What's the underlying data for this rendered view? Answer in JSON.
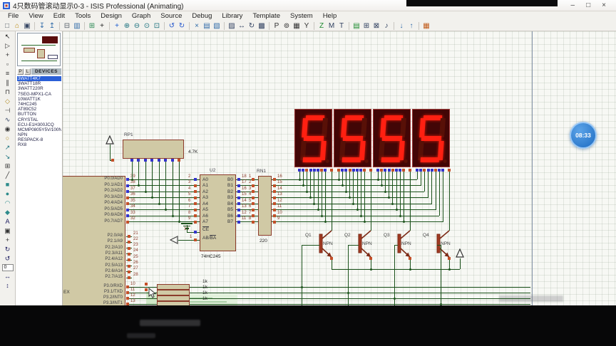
{
  "window": {
    "title": "4只数码管滚动显示0-3 - ISIS Professional (Animating)",
    "controls": {
      "minimize": "–",
      "maximize": "□",
      "close": "×"
    }
  },
  "menu": {
    "items": [
      "File",
      "View",
      "Edit",
      "Tools",
      "Design",
      "Graph",
      "Source",
      "Debug",
      "Library",
      "Template",
      "System",
      "Help"
    ]
  },
  "toolbar": {
    "icons": [
      {
        "name": "new-file-icon",
        "glyph": "□",
        "color": "#55606a"
      },
      {
        "name": "open-design-icon",
        "glyph": "⌂",
        "color": "#b8860b"
      },
      {
        "name": "save-design-icon",
        "glyph": "▣",
        "color": "#3a4a66"
      },
      {
        "name": "separator"
      },
      {
        "name": "import-section-icon",
        "glyph": "↧",
        "color": "#2e6aa8"
      },
      {
        "name": "export-section-icon",
        "glyph": "↥",
        "color": "#2e6aa8"
      },
      {
        "name": "separator"
      },
      {
        "name": "print-icon",
        "glyph": "⊟",
        "color": "#55606a"
      },
      {
        "name": "mark-output-area-icon",
        "glyph": "▥",
        "color": "#2e6aa8"
      },
      {
        "name": "separator"
      },
      {
        "name": "toggle-grid-icon",
        "glyph": "⊞",
        "color": "#2e8b57"
      },
      {
        "name": "false-origin-icon",
        "glyph": "+",
        "color": "#222222"
      },
      {
        "name": "separator"
      },
      {
        "name": "pan-icon",
        "glyph": "+",
        "color": "#1a5ad0"
      },
      {
        "name": "zoom-in-icon",
        "glyph": "⊕",
        "color": "#19707e"
      },
      {
        "name": "zoom-out-icon",
        "glyph": "⊖",
        "color": "#19707e"
      },
      {
        "name": "zoom-all-icon",
        "glyph": "⊙",
        "color": "#19707e"
      },
      {
        "name": "zoom-area-icon",
        "glyph": "⊡",
        "color": "#19707e"
      },
      {
        "name": "separator"
      },
      {
        "name": "undo-icon",
        "glyph": "↺",
        "color": "#2255cc"
      },
      {
        "name": "redo-icon",
        "glyph": "↻",
        "color": "#2255cc"
      },
      {
        "name": "separator"
      },
      {
        "name": "cut-icon",
        "glyph": "×",
        "color": "#2e6aa8"
      },
      {
        "name": "copy-icon",
        "glyph": "▤",
        "color": "#2e6aa8"
      },
      {
        "name": "paste-icon",
        "glyph": "▧",
        "color": "#2e6aa8"
      },
      {
        "name": "separator"
      },
      {
        "name": "block-copy-icon",
        "glyph": "▨",
        "color": "#2f3f5f"
      },
      {
        "name": "block-move-icon",
        "glyph": "↔",
        "color": "#2f3f5f"
      },
      {
        "name": "block-rotate-icon",
        "glyph": "↻",
        "color": "#2f3f5f"
      },
      {
        "name": "block-delete-icon",
        "glyph": "▩",
        "color": "#2f3f5f"
      },
      {
        "name": "separator"
      },
      {
        "name": "pick-parts-icon",
        "glyph": "P",
        "color": "#333333"
      },
      {
        "name": "make-device-icon",
        "glyph": "⊚",
        "color": "#333333"
      },
      {
        "name": "packaging-tool-icon",
        "glyph": "▦",
        "color": "#333333"
      },
      {
        "name": "decompose-icon",
        "glyph": "Y",
        "color": "#333333"
      },
      {
        "name": "separator"
      },
      {
        "name": "wire-autorouter-icon",
        "glyph": "Z",
        "color": "#1c8a2e"
      },
      {
        "name": "search-tag-icon",
        "glyph": "M",
        "color": "#2f3f5f"
      },
      {
        "name": "property-assignment-icon",
        "glyph": "T",
        "color": "#2f3f5f"
      },
      {
        "name": "separator"
      },
      {
        "name": "design-explorer-icon",
        "glyph": "▤",
        "color": "#1c8a2e"
      },
      {
        "name": "new-sheet-icon",
        "glyph": "⊞",
        "color": "#2f3f5f"
      },
      {
        "name": "remove-sheet-icon",
        "glyph": "⊠",
        "color": "#2f3f5f"
      },
      {
        "name": "goto-sheet-icon",
        "glyph": "♪",
        "color": "#2f3f5f"
      },
      {
        "name": "separator"
      },
      {
        "name": "zoom-to-child-icon",
        "glyph": "↓",
        "color": "#2e6aa8"
      },
      {
        "name": "zoom-to-parent-icon",
        "glyph": "↑",
        "color": "#2e6aa8"
      },
      {
        "name": "separator"
      },
      {
        "name": "netlist-to-ares-icon",
        "glyph": "▦",
        "color": "#c05a1a"
      }
    ]
  },
  "side_toolbar": {
    "icons": [
      {
        "name": "selection-tool-icon",
        "glyph": "↖",
        "color": "#111111"
      },
      {
        "name": "component-mode-icon",
        "glyph": "▷",
        "color": "#333333"
      },
      {
        "name": "junction-dot-icon",
        "glyph": "+",
        "color": "#333333"
      },
      {
        "name": "wire-label-icon",
        "glyph": "▫",
        "color": "#333333"
      },
      {
        "name": "text-script-icon",
        "glyph": "≡",
        "color": "#333333"
      },
      {
        "name": "bus-mode-icon",
        "glyph": "∥",
        "color": "#333333"
      },
      {
        "name": "subcircuit-icon",
        "glyph": "⊓",
        "color": "#333333"
      },
      {
        "name": "terminal-mode-icon",
        "glyph": "◇",
        "color": "#b08a20"
      },
      {
        "name": "device-pin-icon",
        "glyph": "⊣",
        "color": "#333333"
      },
      {
        "name": "graph-mode-icon",
        "glyph": "∿",
        "color": "#2f3f5f"
      },
      {
        "name": "tape-recorder-icon",
        "glyph": "◉",
        "color": "#333333"
      },
      {
        "name": "generator-mode-icon",
        "glyph": "○",
        "color": "#b08a20"
      },
      {
        "name": "voltage-probe-icon",
        "glyph": "↗",
        "color": "#19707e"
      },
      {
        "name": "current-probe-icon",
        "glyph": "↘",
        "color": "#19707e"
      },
      {
        "name": "virtual-instruments-icon",
        "glyph": "⊞",
        "color": "#333333"
      },
      {
        "name": "line-2d-icon",
        "glyph": "╱",
        "color": "#333333"
      },
      {
        "name": "box-2d-icon",
        "glyph": "■",
        "color": "#2e8b8b"
      },
      {
        "name": "circle-2d-icon",
        "glyph": "●",
        "color": "#2e8b8b"
      },
      {
        "name": "arc-2d-icon",
        "glyph": "◠",
        "color": "#2e8b8b"
      },
      {
        "name": "path-2d-icon",
        "glyph": "◆",
        "color": "#2e8b8b"
      },
      {
        "name": "text-2d-icon",
        "glyph": "A",
        "color": "#1d1d60"
      },
      {
        "name": "symbol-2d-icon",
        "glyph": "▣",
        "color": "#333333"
      },
      {
        "name": "marker-2d-icon",
        "glyph": "+",
        "color": "#333333"
      },
      {
        "name": "rotate-cw-icon",
        "glyph": "↻",
        "color": "#1d1d60"
      },
      {
        "name": "rotate-ccw-icon",
        "glyph": "↺",
        "color": "#1d1d60"
      },
      {
        "name": "angle-field",
        "value": "0"
      },
      {
        "name": "mirror-horizontal-icon",
        "glyph": "↔",
        "color": "#1d1d60"
      },
      {
        "name": "mirror-vertical-icon",
        "glyph": "↕",
        "color": "#1d1d60"
      }
    ]
  },
  "object_selector": {
    "buttons": [
      "P",
      "L"
    ],
    "header": "DEVICES",
    "selected": "3WATT4K7",
    "devices": [
      "3WATT4K7",
      "3WATT18R",
      "3WATT220R",
      "7SEG-MPX1-CA",
      "10WATT1K",
      "74HC245",
      "AT89C52",
      "BUTTON",
      "CRYSTAL",
      "ECU-E1H300JCQ",
      "MCMP0805Y5V/100N",
      "NPN",
      "RESPACK-8",
      "RX8"
    ]
  },
  "circuit": {
    "rp1": {
      "ref": "RP1",
      "value": "4.7K"
    },
    "mcu": {
      "ex_label": "EX",
      "p0_pins": [
        {
          "name": "P0.0/AD0",
          "num": "39"
        },
        {
          "name": "P0.1/AD1",
          "num": "38"
        },
        {
          "name": "P0.2/AD2",
          "num": "37"
        },
        {
          "name": "P0.3/AD3",
          "num": "36"
        },
        {
          "name": "P0.4/AD4",
          "num": "35"
        },
        {
          "name": "P0.5/AD5",
          "num": "34"
        },
        {
          "name": "P0.6/AD6",
          "num": "33"
        },
        {
          "name": "P0.7/AD7",
          "num": "32"
        }
      ],
      "p2_pins": [
        {
          "name": "P2.0/A8",
          "num": "21"
        },
        {
          "name": "P2.1/A9",
          "num": "22"
        },
        {
          "name": "P2.2/A10",
          "num": "23"
        },
        {
          "name": "P2.3/A11",
          "num": "24"
        },
        {
          "name": "P2.4/A12",
          "num": "25"
        },
        {
          "name": "P2.5/A13",
          "num": "26"
        },
        {
          "name": "P2.6/A14",
          "num": "27"
        },
        {
          "name": "P2.7/A15",
          "num": "28"
        }
      ],
      "p3_pins": [
        {
          "name": "P3.0/RXD",
          "num": "10"
        },
        {
          "name": "P3.1/TXD",
          "num": "11"
        },
        {
          "name": "P3.2/INT0",
          "num": "12"
        },
        {
          "name": "P3.3/INT1",
          "num": "13"
        }
      ]
    },
    "u2": {
      "ref": "U2",
      "part": "74HC245",
      "a_labels": [
        "A0",
        "A1",
        "A2",
        "A3",
        "A4",
        "A5",
        "A6",
        "A7"
      ],
      "a_nums": [
        "2",
        "3",
        "4",
        "5",
        "6",
        "7",
        "8",
        "9"
      ],
      "b_labels": [
        "B0",
        "B1",
        "B2",
        "B3",
        "B4",
        "B5",
        "B6",
        "B7"
      ],
      "b_nums": [
        "18",
        "17",
        "16",
        "15",
        "14",
        "13",
        "12",
        "11"
      ],
      "ce": "CE",
      "ce_num": "19",
      "dir_plain": "AB/",
      "dir_bar": "BA",
      "dir_num": "1"
    },
    "rn1": {
      "ref": "RN1",
      "value": "220",
      "left_nums": [
        "1",
        "2",
        "3",
        "4",
        "5",
        "6",
        "7",
        "8"
      ],
      "right_nums": [
        "16",
        "15",
        "14",
        "13",
        "12",
        "11",
        "10",
        "9"
      ]
    },
    "displays": {
      "digits": [
        "5",
        "5",
        "5",
        "5"
      ]
    },
    "transistors": [
      {
        "ref": "Q1",
        "type": "NPN"
      },
      {
        "ref": "Q2",
        "type": "NPN"
      },
      {
        "ref": "Q3",
        "type": "NPN"
      },
      {
        "ref": "Q4",
        "type": "NPN"
      }
    ],
    "base_resistors": {
      "value": "1k"
    },
    "logic_states": {
      "mcu_p0": [
        "l",
        "l",
        "l",
        "h",
        "h",
        "l",
        "l",
        "h"
      ],
      "mcu_p2": [
        "h",
        "h",
        "h",
        "h",
        "h",
        "h",
        "h",
        "h"
      ],
      "mcu_p3": [
        "h",
        "h",
        "h",
        "h"
      ],
      "u2_a": [
        "l",
        "h",
        "h",
        "h",
        "h",
        "h",
        "h",
        "h"
      ],
      "u2_b": [
        "l",
        "l",
        "l",
        "l",
        "l",
        "l",
        "l",
        "l"
      ],
      "u2_ce": "l",
      "u2_dir": "h",
      "rn1_left": [
        "h",
        "h",
        "h",
        "h",
        "h",
        "h",
        "h",
        "h"
      ],
      "rn1_right": [
        "h",
        "h",
        "h",
        "h",
        "h",
        "h",
        "h",
        "h"
      ],
      "rp1_common": "h",
      "rp1_pins": [
        "l",
        "l",
        "l",
        "l",
        "l",
        "l",
        "l",
        "h"
      ],
      "display_pins": [
        [
          "l",
          "l",
          "h",
          "l",
          "l",
          "l",
          "h",
          "l"
        ],
        [
          "h",
          "l",
          "l",
          "h",
          "l",
          "l",
          "l",
          "h"
        ],
        [
          "l",
          "h",
          "l",
          "l",
          "h",
          "l",
          "l",
          "h"
        ],
        [
          "l",
          "l",
          "h",
          "l",
          "l",
          "h",
          "l",
          "l"
        ]
      ],
      "display_commons": [
        "h",
        "h",
        "h",
        "h"
      ],
      "q_emitters": [
        "h",
        "h",
        "h",
        "h"
      ],
      "p3_floating": [
        "h",
        "h"
      ]
    },
    "colors": {
      "wire": "#1b521b",
      "logic_high": "#c44f28",
      "logic_low": "#3333cc",
      "body": "#d0c9a5",
      "body_border": "#8c3b2b",
      "segment_on": "#ff2012",
      "segment_off": "#581007",
      "display_bg": "#420606",
      "display_border": "#9c3434"
    }
  },
  "overlay": {
    "time_badge": "08:33"
  }
}
